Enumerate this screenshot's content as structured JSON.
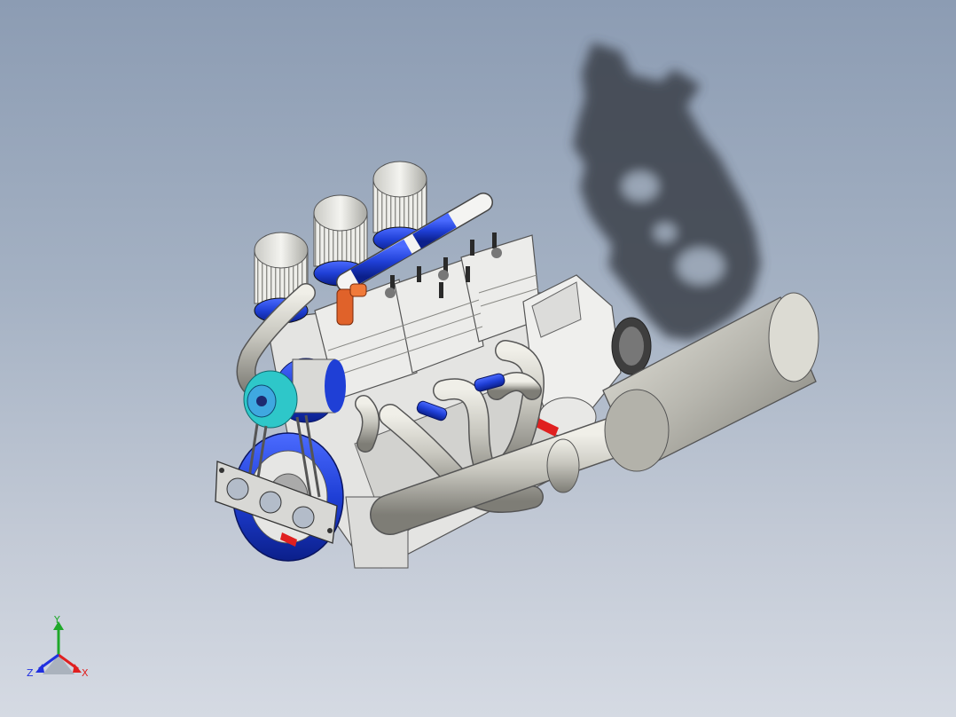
{
  "viewport": {
    "background_top": "#8c9cb3",
    "background_bottom": "#d5dae3"
  },
  "model": {
    "colors": {
      "engine_block": "#e6e6e6",
      "accent_blue": "#1f3fd6",
      "exhaust_metal": "#b9b8b0",
      "fuel_fitting": "#e0622a",
      "pulley_teal": "#2ec7c9",
      "shadow": "#333940"
    }
  },
  "triad": {
    "x_label": "X",
    "y_label": "Y",
    "z_label": "Z",
    "x_color": "#e02020",
    "y_color": "#1fa82a",
    "z_color": "#2030e0"
  }
}
